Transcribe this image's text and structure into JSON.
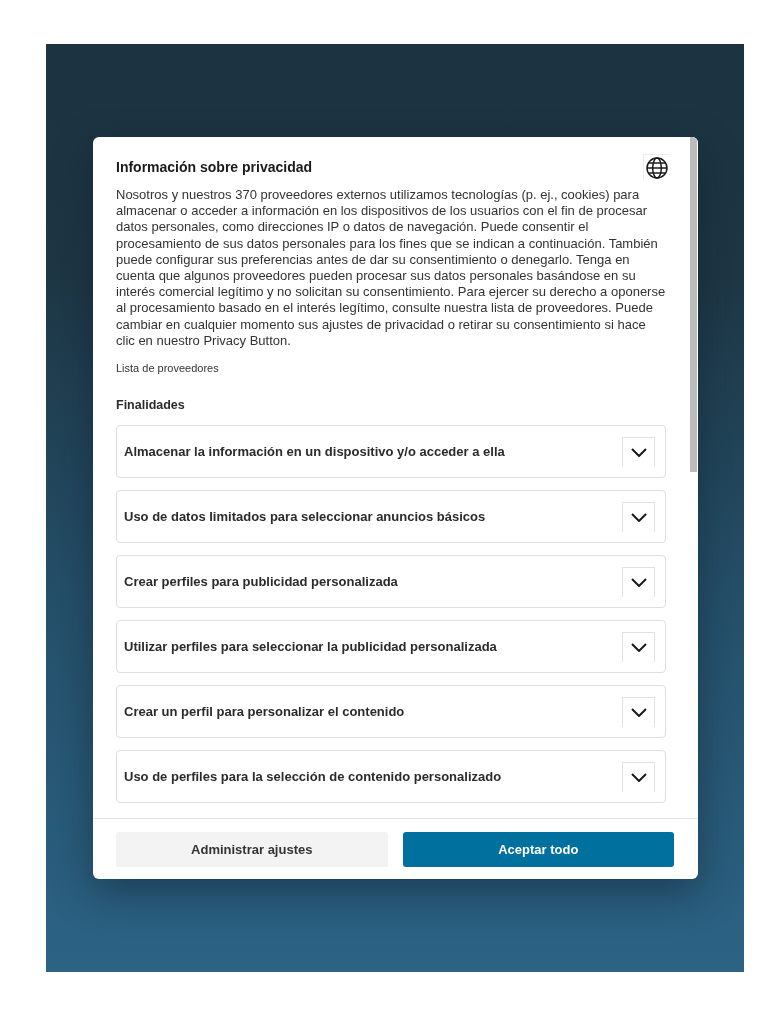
{
  "dialog": {
    "title": "Información sobre privacidad",
    "description": "Nosotros y nuestros 370 proveedores externos utilizamos tecnologías (p. ej., cookies) para almacenar o acceder a información en los dispositivos de los usuarios con el fin de procesar datos personales, como direcciones IP o datos de navegación. Puede consentir el procesamiento de sus datos personales para los fines que se indican a continuación. También puede configurar sus preferencias antes de dar su consentimiento o denegarlo. Tenga en cuenta que algunos proveedores pueden procesar sus datos personales basándose en su interés comercial legítimo y no solicitan su consentimiento. Para ejercer su derecho a oponerse al procesamiento basado en el interés legítimo, consulte nuestra lista de proveedores. Puede cambiar en cualquier momento sus ajustes de privacidad o retirar su consentimiento si hace clic en nuestro Privacy Button.",
    "vendor_link": "Lista de proveedores",
    "purposes_heading": "Finalidades",
    "purposes": [
      {
        "label": "Almacenar la información en un dispositivo y/o acceder a ella",
        "expanded": false
      },
      {
        "label": "Uso de datos limitados para seleccionar anuncios básicos",
        "expanded": false
      },
      {
        "label": "Crear perfiles para publicidad personalizada",
        "expanded": false
      },
      {
        "label": "Utilizar perfiles para seleccionar la publicidad personalizada",
        "expanded": false
      },
      {
        "label": "Crear un perfil para personalizar el contenido",
        "expanded": false
      },
      {
        "label": "Uso de perfiles para la selección de contenido personalizado",
        "expanded": false
      }
    ],
    "buttons": [
      {
        "label": "Administrar ajustes",
        "kind": "secondary"
      },
      {
        "label": "Aceptar todo",
        "kind": "primary"
      }
    ]
  }
}
